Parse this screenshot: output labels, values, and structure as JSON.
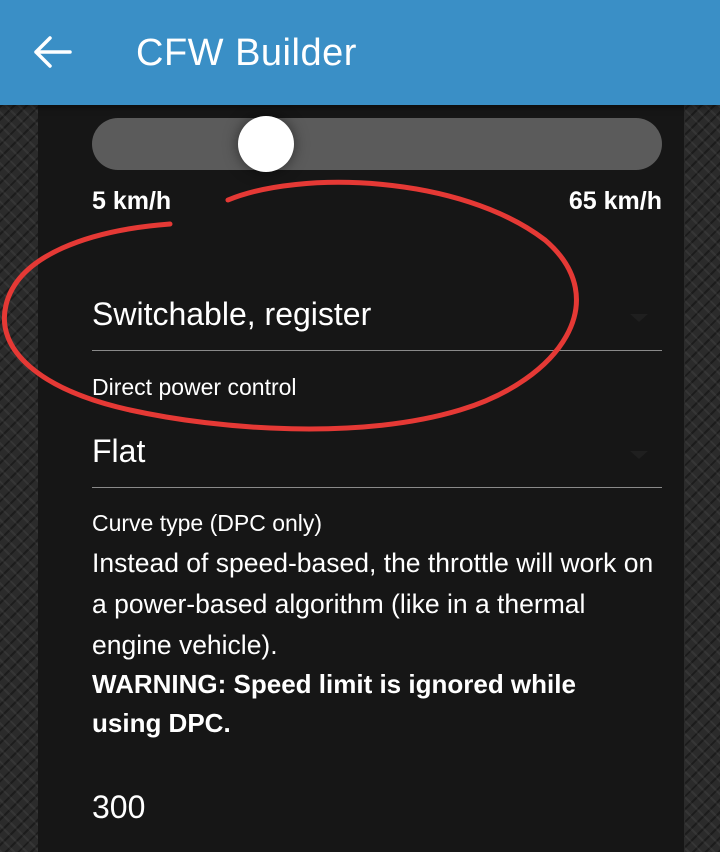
{
  "appbar": {
    "title": "CFW Builder"
  },
  "speed_slider": {
    "min_label": "5 km/h",
    "max_label": "65 km/h",
    "value_fraction": 0.305
  },
  "mode_dropdown": {
    "selected": "Switchable, register"
  },
  "dpc_section": {
    "label": "Direct power control"
  },
  "curve_dropdown": {
    "selected": "Flat"
  },
  "curve_section": {
    "label": "Curve type (DPC only)",
    "description": "Instead of speed-based, the throttle will work on a power-based algorithm (like in a thermal engine vehicle).",
    "warning": "WARNING: Speed limit is ignored while using DPC."
  },
  "number_field": {
    "value": "300"
  },
  "colors": {
    "appbar": "#3a8fc6",
    "annotation": "#e53935",
    "panel": "#161616",
    "track": "#5b5b5b"
  },
  "icons": {
    "back": "arrow-left-icon",
    "dropdown": "caret-down-icon"
  }
}
